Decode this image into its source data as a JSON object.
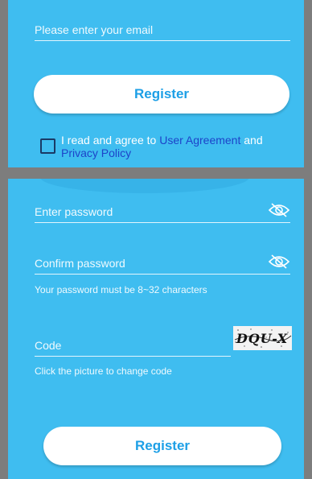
{
  "top": {
    "email_placeholder": "Please enter your email",
    "register_label": "Register",
    "agree_prefix": "I read and agree to ",
    "user_agreement": "User Agreement",
    "and_word": " and ",
    "privacy_policy": "Privacy Policy"
  },
  "bottom": {
    "password_placeholder": "Enter password",
    "confirm_placeholder": "Confirm password",
    "password_hint": "Your password must be 8~32 characters",
    "code_placeholder": "Code",
    "captcha_text": "DQU-X",
    "captcha_hint": "Click the picture to change code",
    "register_label": "Register"
  },
  "colors": {
    "panel": "#3fbdf0",
    "frame": "#7d7d7d",
    "button_text": "#1d9fe6",
    "link": "#1d43c9"
  }
}
